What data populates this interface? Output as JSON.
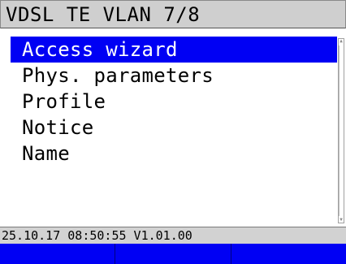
{
  "title": "VDSL TE VLAN 7/8",
  "menu": {
    "items": [
      {
        "label": "Access wizard"
      },
      {
        "label": "Phys. parameters"
      },
      {
        "label": "Profile"
      },
      {
        "label": "Notice"
      },
      {
        "label": "Name"
      }
    ],
    "selected_label": "Access wizard"
  },
  "status": {
    "text": "25.10.17 08:50:55 V1.01.00"
  },
  "softkeys": [
    "",
    "",
    ""
  ],
  "colors": {
    "selection": "#0000f4",
    "title_bg": "#cfcfcf",
    "status_bg": "#d2d2d2",
    "softkey_bg": "#0000f4"
  },
  "icons": {
    "scroll_up": "arrow-up-icon",
    "scroll_down": "arrow-down-icon"
  }
}
